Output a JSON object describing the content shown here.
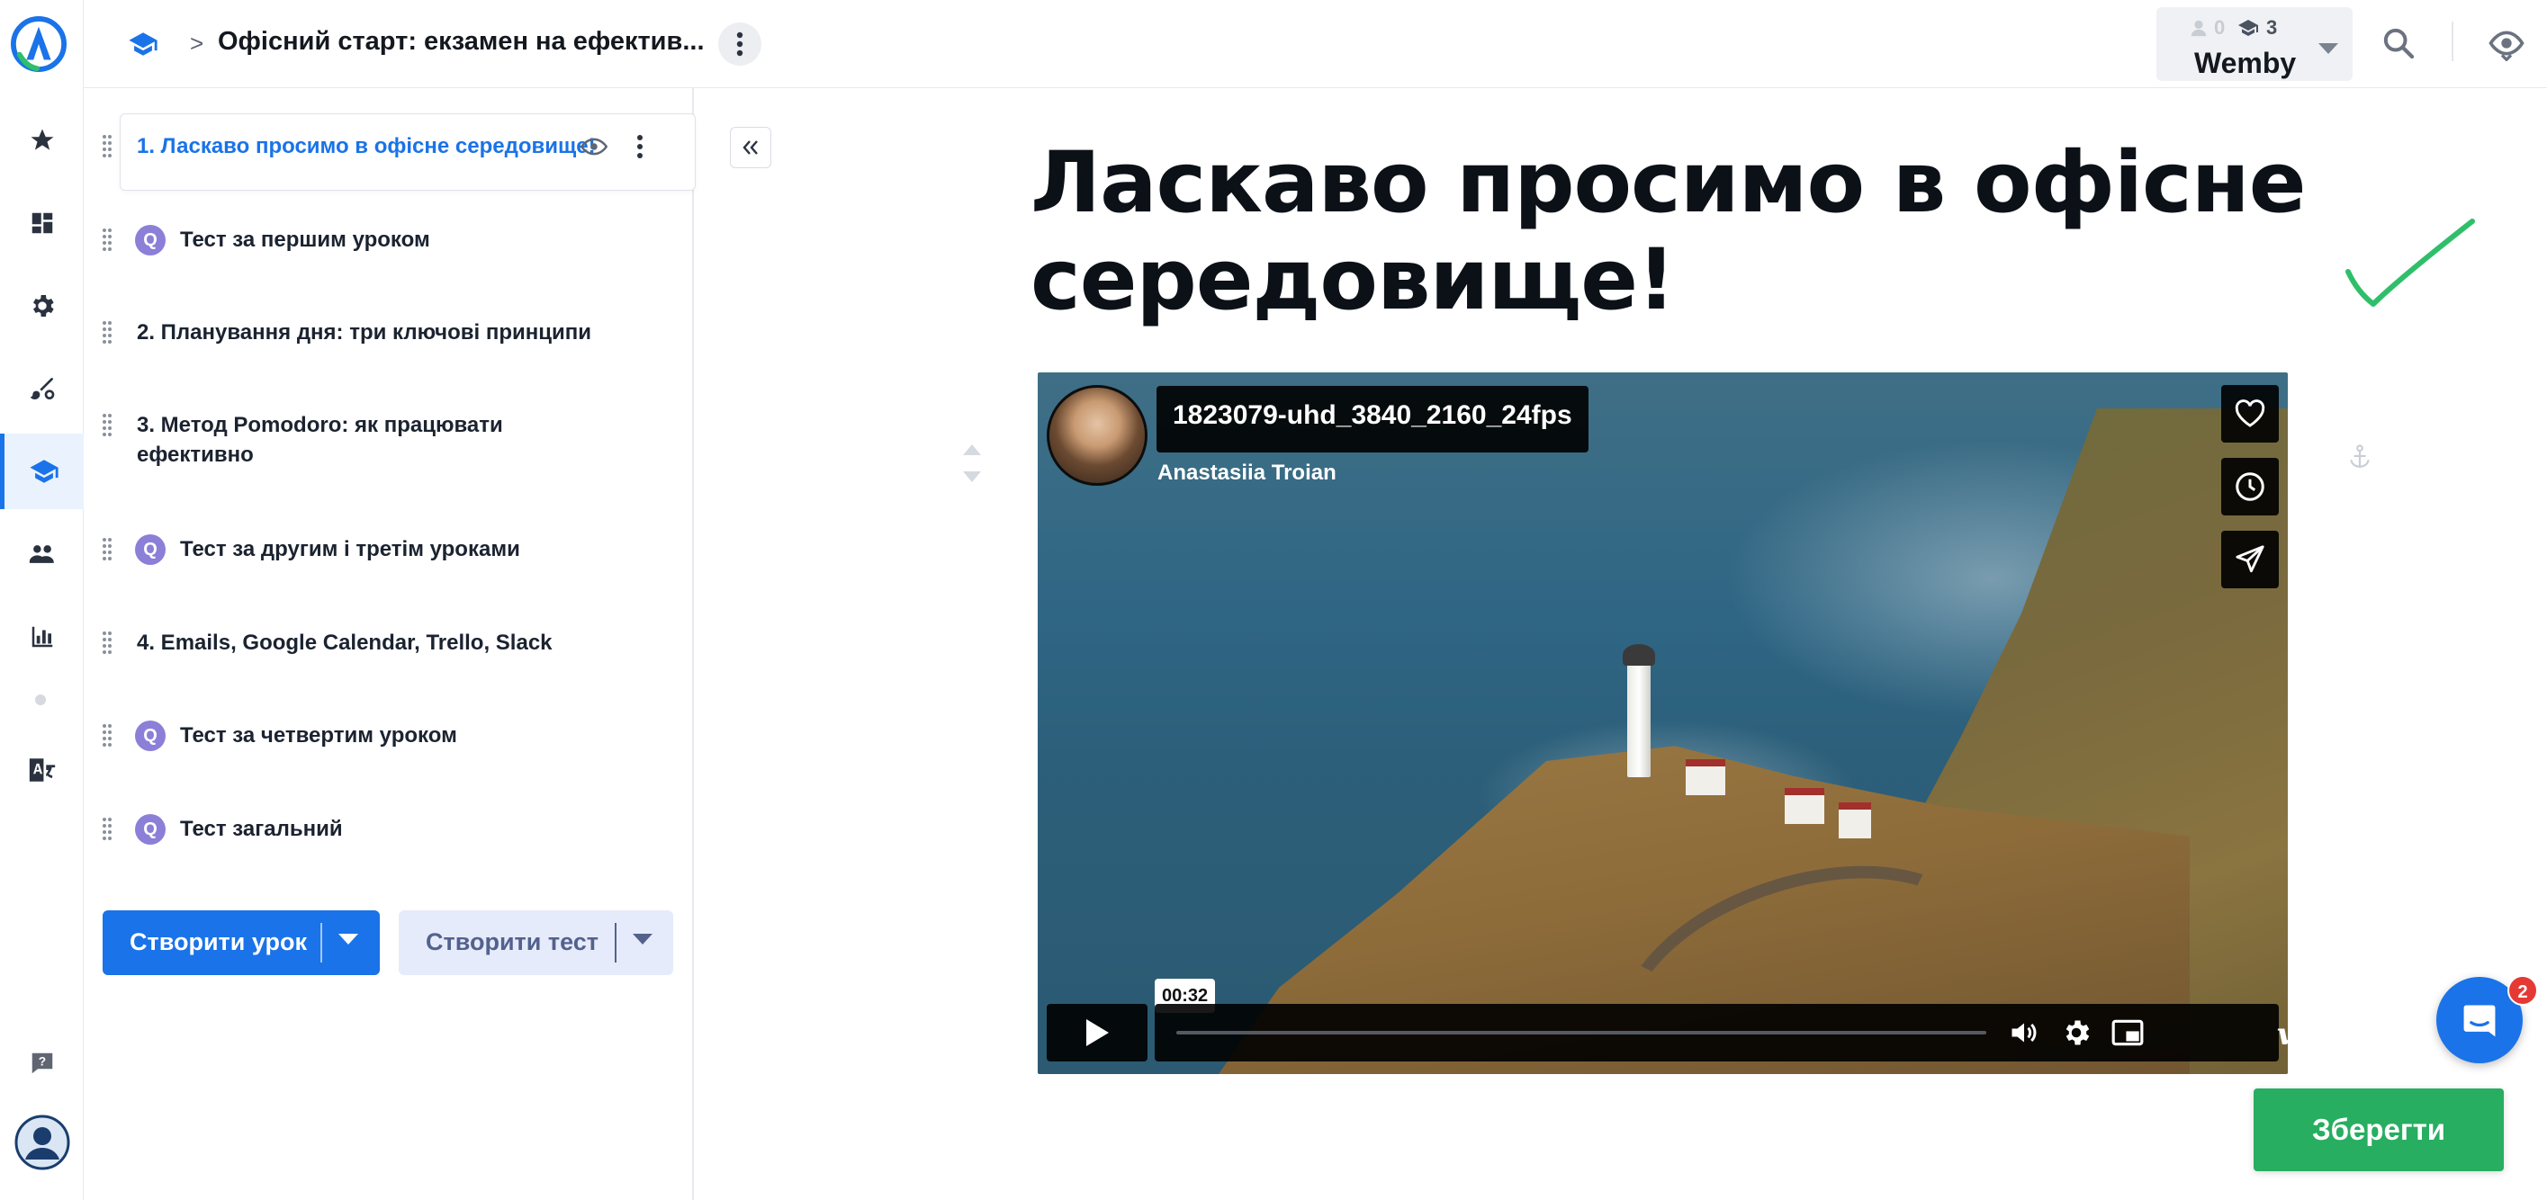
{
  "breadcrumb": {
    "separator": ">",
    "title": "Офісний старт: екзамен на ефектив..."
  },
  "account": {
    "users_count": "0",
    "courses_count": "3",
    "name": "Wemby"
  },
  "lessons": [
    {
      "label": "1. Ласкаво просимо в офісне середовище!",
      "quiz": false,
      "selected": true
    },
    {
      "label": "Тест за першим уроком",
      "quiz": true,
      "badge": "Q"
    },
    {
      "label": "2. Планування дня: три ключові принципи",
      "quiz": false
    },
    {
      "label": "3. Метод Pomodoro: як працювати",
      "label_line2": "ефективно",
      "quiz": false
    },
    {
      "label": "Тест за другим і третім уроками",
      "quiz": true,
      "badge": "Q"
    },
    {
      "label": "4. Emails, Google Calendar, Trello, Slack",
      "quiz": false
    },
    {
      "label": "Тест за четвертим уроком",
      "quiz": true,
      "badge": "Q"
    },
    {
      "label": "Тест загальний",
      "quiz": true,
      "badge": "Q"
    }
  ],
  "actions": {
    "create_lesson": "Створити урок",
    "create_test": "Створити тест",
    "save": "Зберегти"
  },
  "content": {
    "heading": "Ласкаво просимо в офісне середовище!"
  },
  "video": {
    "title": "1823079-uhd_3840_2160_24fps",
    "author": "Anastasiia Troian",
    "time": "00:32",
    "brand": "vimeo"
  },
  "chat": {
    "unread": "2"
  },
  "colors": {
    "accent": "#1a73e8",
    "save": "#27ae60",
    "quiz_badge": "#8b7fd8",
    "check": "#2fbf6a"
  }
}
